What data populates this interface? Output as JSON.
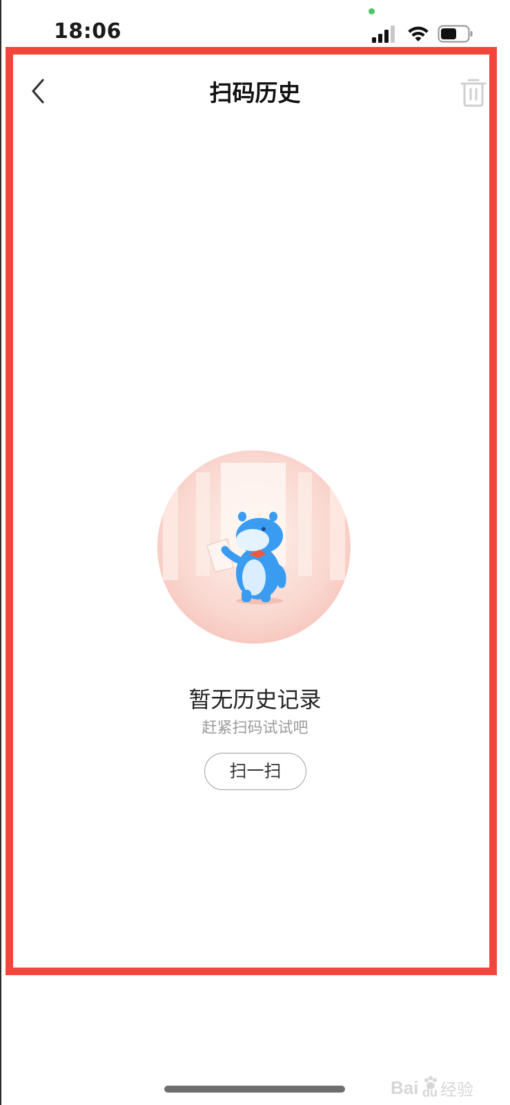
{
  "status_bar": {
    "time": "18:06"
  },
  "header": {
    "title": "扫码历史",
    "back_icon": "chevron-left-icon",
    "delete_icon": "trash-icon"
  },
  "empty_state": {
    "illustration": "mascot-holding-paper-illustration",
    "title": "暂无历史记录",
    "subtitle": "赶紧扫码试试吧",
    "scan_button_label": "扫一扫"
  },
  "watermark": {
    "text": "Baidu经验"
  },
  "colors": {
    "highlight_frame": "#f2453b",
    "illustration_circle": "#fbd9d2",
    "mascot_blue": "#3ea0f2",
    "subtitle_gray": "#9a9a9a",
    "button_border": "#9d9d9d"
  }
}
